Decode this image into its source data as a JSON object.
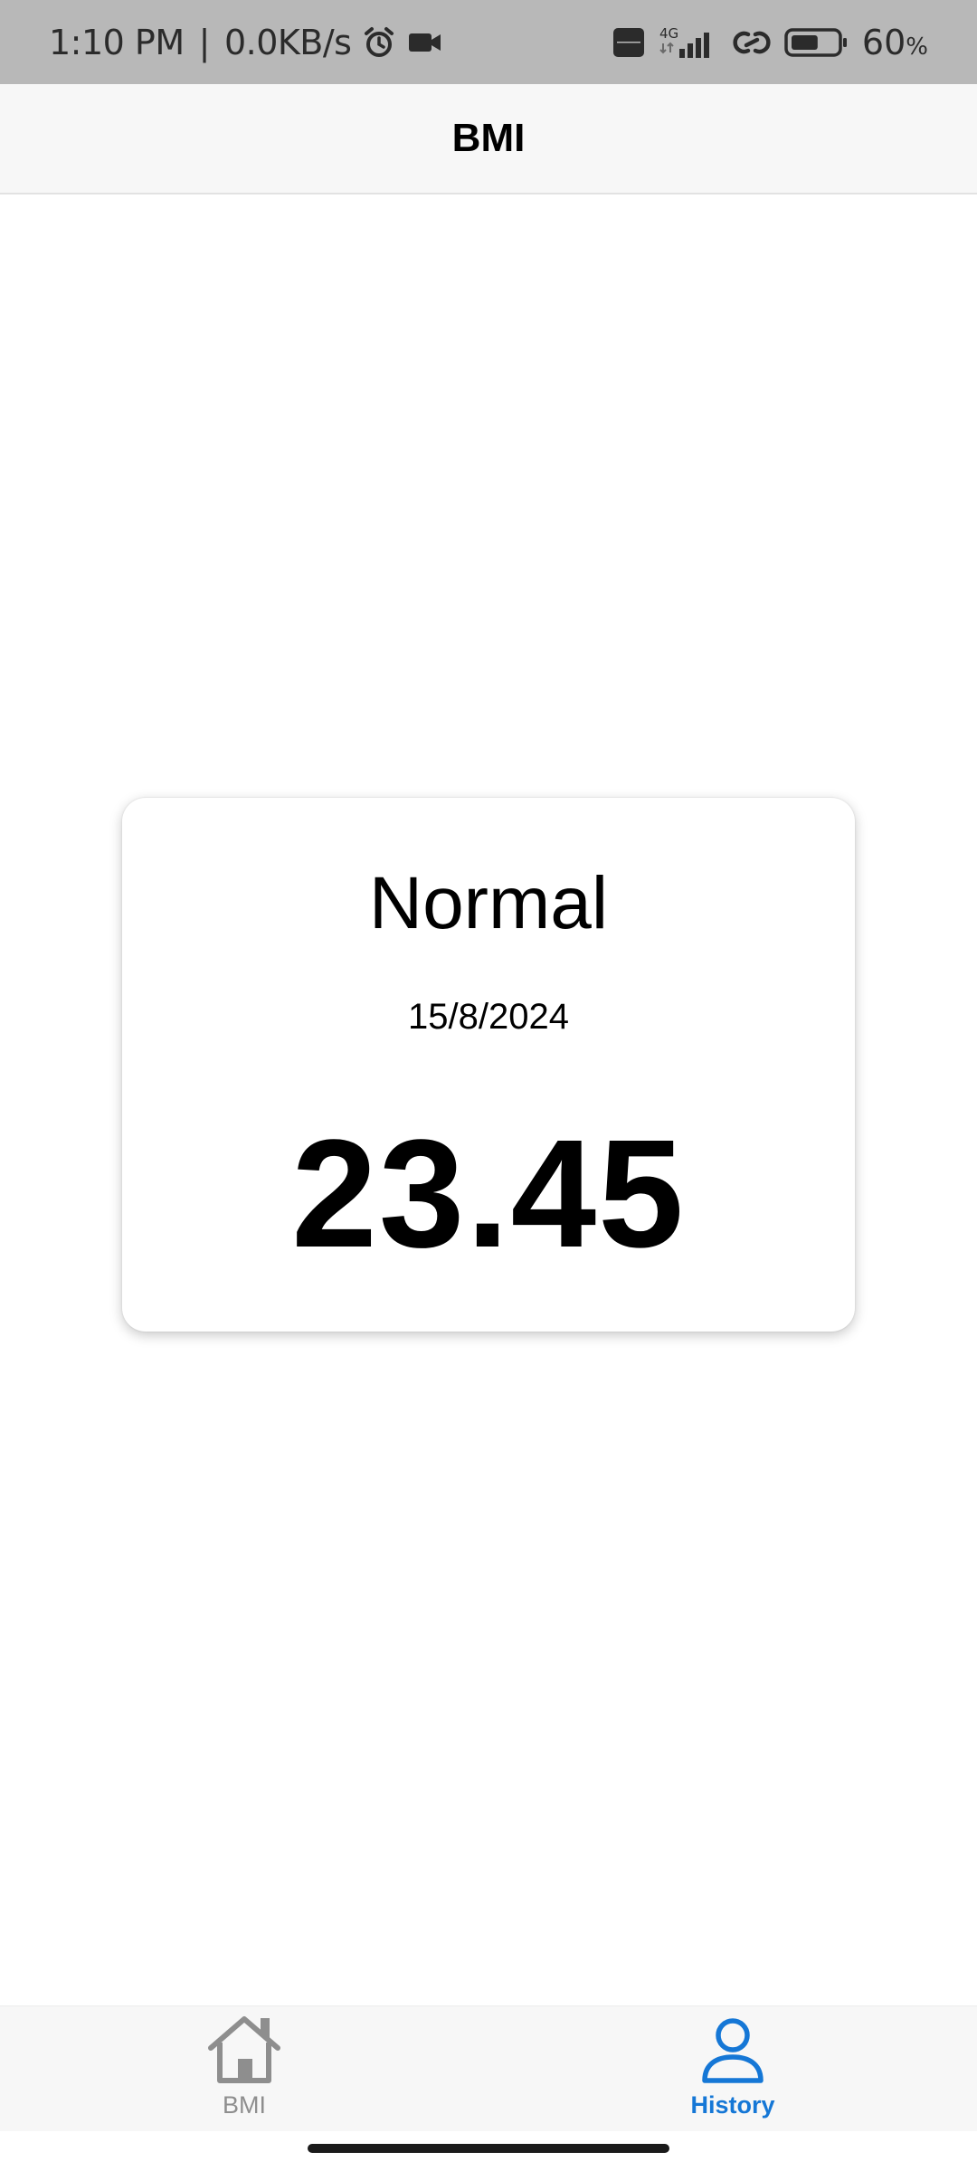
{
  "status_bar": {
    "time": "1:10 PM",
    "separator": "|",
    "network_speed": "0.0KB/s",
    "icons": [
      "alarm-icon",
      "video-camera-icon",
      "volte-icon",
      "signal-4g-icon",
      "link-icon",
      "battery-icon"
    ],
    "network_type": "4G",
    "battery_percent": "60",
    "battery_unit": "%",
    "battery_level": 0.6
  },
  "header": {
    "title": "BMI"
  },
  "result": {
    "category": "Normal",
    "date": "15/8/2024",
    "bmi": "23.45"
  },
  "tab_bar": {
    "tabs": [
      {
        "label": "BMI",
        "icon": "home-icon",
        "active": false
      },
      {
        "label": "History",
        "icon": "person-icon",
        "active": true
      }
    ],
    "active_color": "#1577d6",
    "inactive_color": "#8e8e8e"
  }
}
